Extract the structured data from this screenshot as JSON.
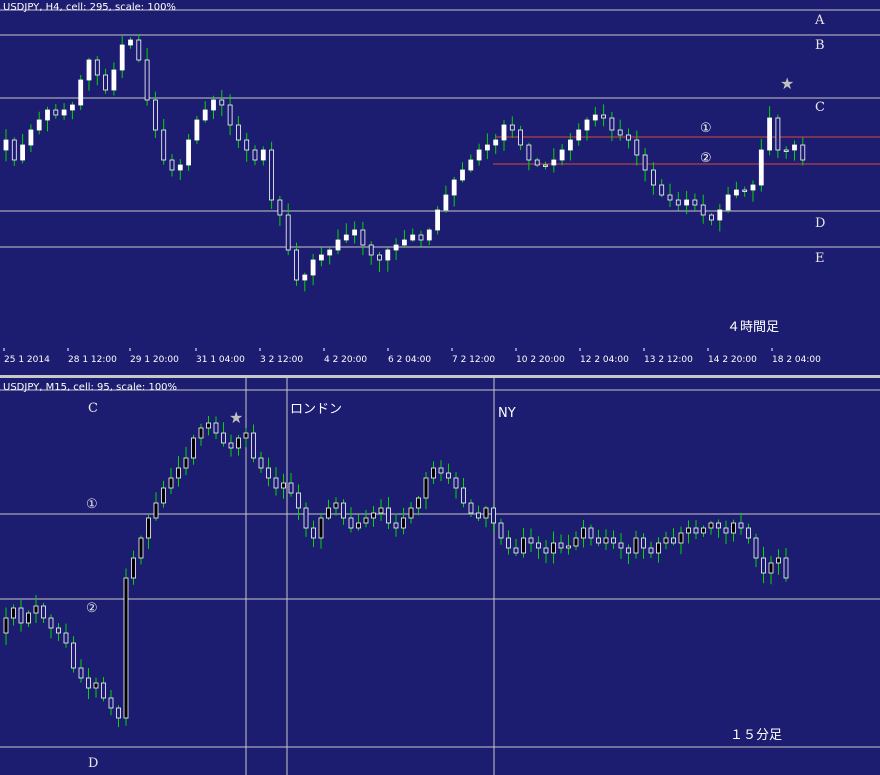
{
  "chart_data": [
    {
      "type": "candlestick",
      "header": "USDJPY, H4, cell: 295, scale: 100%",
      "timeframe_note": "４時間足",
      "x_tick_labels": [
        "25 1 2014",
        "28 1 12:00",
        "29 1 20:00",
        "31 1 04:00",
        "3 2 12:00",
        "4 2 20:00",
        "6 2 04:00",
        "7 2 12:00",
        "10 2 20:00",
        "12 2 04:00",
        "13 2 12:00",
        "14 2 20:00",
        "18 2 04:00"
      ],
      "levels": [
        {
          "label": "A",
          "color": "#c8c8c8"
        },
        {
          "label": "B",
          "color": "#c8c8c8"
        },
        {
          "label": "C",
          "color": "#c8c8c8"
        },
        {
          "label": "D",
          "color": "#c8c8c8"
        },
        {
          "label": "E",
          "color": "#c8c8c8"
        }
      ],
      "markers": [
        "①",
        "②",
        "★"
      ],
      "colors": {
        "background": "#1c1c70",
        "bull": "#ffffff",
        "bear": "#ffffff",
        "wick": "#00d800",
        "level_line": "#c8c8c8",
        "marker_line": "#d84a3a",
        "star": "#c0c0c0"
      }
    },
    {
      "type": "candlestick",
      "header": "USDJPY, M15, cell: 95, scale: 100%",
      "timeframe_note": "１５分足",
      "levels": [
        {
          "label": "C",
          "color": "#c8c8c8"
        },
        {
          "label": "①",
          "color": "#c8c8c8"
        },
        {
          "label": "②",
          "color": "#c8c8c8"
        },
        {
          "label": "D",
          "color": "#c8c8c8"
        }
      ],
      "sessions": [
        "ロンドン",
        "NY"
      ],
      "markers": [
        "★"
      ],
      "colors": {
        "background": "#1c1c70",
        "body": "#ffffff",
        "wick": "#00d800",
        "level_line": "#c8c8c8",
        "session_line": "#c8c8c8",
        "star": "#c0c0c0"
      }
    }
  ]
}
